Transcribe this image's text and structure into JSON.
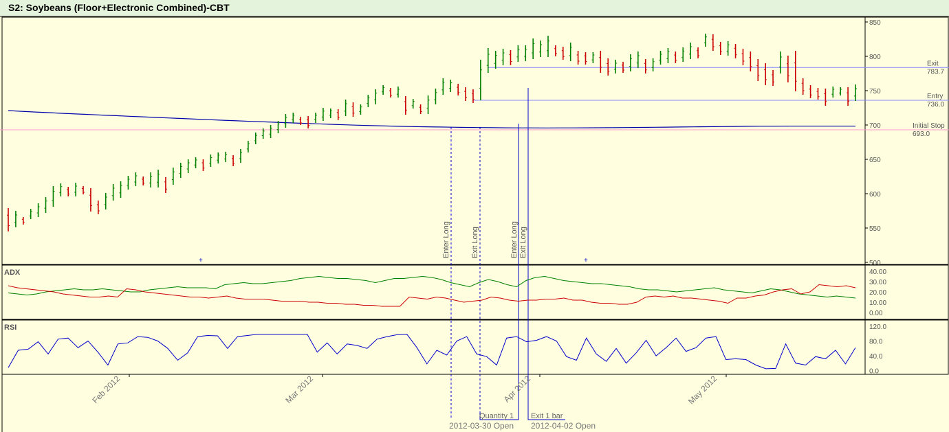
{
  "title": "S2: Soybeans (Floor+Electronic Combined)-CBT",
  "chart_data": [
    {
      "type": "bar",
      "subtype": "ohlc",
      "yticks": [
        "850",
        "800",
        "750",
        "700",
        "650",
        "600",
        "550",
        "500"
      ],
      "ylim": [
        497,
        857
      ],
      "xticks": [
        "Feb 2012",
        "Mar 2012",
        "Apr 2012",
        "May 2012"
      ],
      "colors": {
        "up": "#008000",
        "down": "#cc0000",
        "ma": "#0000aa"
      },
      "bars": [
        [
          579,
          545
        ],
        [
          575,
          551
        ],
        [
          566,
          555
        ],
        [
          578,
          563
        ],
        [
          586,
          566
        ],
        [
          595,
          572
        ],
        [
          611,
          581
        ],
        [
          615,
          596
        ],
        [
          610,
          596
        ],
        [
          616,
          596
        ],
        [
          611,
          599
        ],
        [
          608,
          574
        ],
        [
          590,
          570
        ],
        [
          601,
          577
        ],
        [
          614,
          590
        ],
        [
          618,
          594
        ],
        [
          626,
          606
        ],
        [
          631,
          611
        ],
        [
          625,
          612
        ],
        [
          631,
          609
        ],
        [
          635,
          609
        ],
        [
          624,
          601
        ],
        [
          638,
          613
        ],
        [
          645,
          623
        ],
        [
          650,
          630
        ],
        [
          653,
          637
        ],
        [
          650,
          633
        ],
        [
          657,
          639
        ],
        [
          660,
          644
        ],
        [
          661,
          646
        ],
        [
          656,
          640
        ],
        [
          665,
          645
        ],
        [
          677,
          660
        ],
        [
          689,
          672
        ],
        [
          695,
          680
        ],
        [
          700,
          681
        ],
        [
          706,
          688
        ],
        [
          716,
          696
        ],
        [
          718,
          703
        ],
        [
          712,
          700
        ],
        [
          713,
          695
        ],
        [
          718,
          703
        ],
        [
          725,
          706
        ],
        [
          724,
          710
        ],
        [
          723,
          707
        ],
        [
          737,
          713
        ],
        [
          733,
          712
        ],
        [
          730,
          715
        ],
        [
          744,
          726
        ],
        [
          752,
          730
        ],
        [
          758,
          744
        ],
        [
          754,
          740
        ],
        [
          756,
          740
        ],
        [
          742,
          715
        ],
        [
          738,
          724
        ],
        [
          730,
          716
        ],
        [
          743,
          716
        ],
        [
          753,
          730
        ],
        [
          768,
          744
        ],
        [
          766,
          748
        ],
        [
          760,
          743
        ],
        [
          755,
          735
        ],
        [
          752,
          732
        ],
        [
          795,
          736
        ],
        [
          812,
          776
        ],
        [
          808,
          782
        ],
        [
          811,
          787
        ],
        [
          809,
          787
        ],
        [
          816,
          792
        ],
        [
          816,
          793
        ],
        [
          826,
          796
        ],
        [
          823,
          799
        ],
        [
          830,
          799
        ],
        [
          816,
          800
        ],
        [
          814,
          795
        ],
        [
          820,
          793
        ],
        [
          808,
          788
        ],
        [
          806,
          788
        ],
        [
          806,
          790
        ],
        [
          808,
          776
        ],
        [
          797,
          772
        ],
        [
          795,
          775
        ],
        [
          792,
          776
        ],
        [
          803,
          778
        ],
        [
          807,
          783
        ],
        [
          796,
          775
        ],
        [
          797,
          778
        ],
        [
          808,
          788
        ],
        [
          812,
          790
        ],
        [
          807,
          790
        ],
        [
          813,
          792
        ],
        [
          820,
          796
        ],
        [
          813,
          797
        ],
        [
          833,
          814
        ],
        [
          832,
          808
        ],
        [
          821,
          802
        ],
        [
          822,
          801
        ],
        [
          818,
          797
        ],
        [
          811,
          787
        ],
        [
          807,
          778
        ],
        [
          796,
          764
        ],
        [
          790,
          758
        ],
        [
          780,
          757
        ],
        [
          807,
          775
        ],
        [
          801,
          762
        ],
        [
          808,
          749
        ],
        [
          768,
          744
        ],
        [
          758,
          739
        ],
        [
          754,
          737
        ],
        [
          753,
          728
        ],
        [
          756,
          740
        ],
        [
          755,
          743
        ],
        [
          755,
          728
        ],
        [
          759,
          735
        ]
      ],
      "series": [
        {
          "values": [
            721.0,
            719.9,
            718.9,
            718.0,
            717.0,
            716.1,
            715.3,
            714.4,
            713.6,
            712.7,
            711.9,
            711.0,
            710.2,
            709.4,
            708.5,
            707.7,
            706.9,
            706.1,
            705.3,
            704.6,
            703.9,
            703.1,
            702.4,
            701.7,
            701.0,
            700.3,
            699.7,
            699.1,
            698.6,
            698.1,
            697.7,
            697.4,
            697.1,
            696.8,
            696.5,
            696.3,
            696.1,
            695.9,
            695.8,
            695.8,
            695.7,
            695.8,
            695.8,
            695.9,
            696.0,
            696.1,
            696.3,
            696.5,
            696.7,
            696.9,
            697.1,
            697.3,
            697.5,
            697.7,
            697.9,
            698.1,
            698.2,
            698.2,
            698.3,
            698.3,
            698.3,
            698.3,
            698.3,
            698.3
          ]
        }
      ],
      "annotations": [
        {
          "label": "Exit",
          "value_label": "783.7",
          "value": 783.7
        },
        {
          "label": "Entry",
          "value_label": "736.0",
          "value": 736.0
        },
        {
          "label": "Initial Stop",
          "value_label": "693.0",
          "value": 693.0
        }
      ],
      "signals": [
        "Enter Long",
        "Exit Long",
        "Enter Long",
        "Exit Long"
      ],
      "trade_labels": [
        "Quantity 1",
        "2012-03-30 Open",
        "Exit 1 bar",
        "2012-04-02 Open"
      ]
    },
    {
      "type": "line",
      "panel": "ADX",
      "title": "ADX",
      "yticks": [
        "40.00",
        "30.00",
        "20.00",
        "10.00",
        "0.00"
      ],
      "ylim": [
        0,
        40
      ],
      "series": [
        {
          "color": "#008000",
          "values": [
            19,
            18,
            17,
            18,
            20,
            21,
            22,
            23,
            22,
            22,
            23,
            22,
            21,
            20,
            20,
            22,
            23,
            24,
            25,
            24,
            24,
            24,
            23,
            27,
            28,
            29,
            28,
            28,
            29,
            30,
            31,
            33,
            34,
            35,
            34,
            33,
            33,
            32,
            31,
            29,
            31,
            33,
            33,
            34,
            35,
            34,
            32,
            29,
            27,
            25,
            29,
            32,
            30,
            27,
            25,
            31,
            34,
            35,
            33,
            31,
            30,
            29,
            28,
            28,
            27,
            26,
            25,
            23,
            22,
            22,
            21,
            20,
            21,
            22,
            23,
            24,
            22,
            21,
            20,
            19,
            21,
            23,
            22,
            20,
            18,
            17,
            16,
            15,
            16,
            15,
            14
          ]
        },
        {
          "color": "#cc0000",
          "values": [
            26,
            24,
            23,
            22,
            21,
            20,
            18,
            17,
            16,
            15,
            15,
            16,
            15,
            23,
            22,
            20,
            19,
            18,
            17,
            16,
            15,
            15,
            14,
            15,
            16,
            14,
            13,
            13,
            13,
            12,
            11,
            11,
            11,
            10,
            10,
            9,
            9,
            8,
            8,
            7,
            7,
            6,
            6,
            6,
            15,
            14,
            13,
            15,
            14,
            12,
            10,
            11,
            12,
            15,
            14,
            12,
            11,
            12,
            12,
            13,
            13,
            14,
            12,
            12,
            10,
            9,
            9,
            8,
            8,
            10,
            15,
            16,
            15,
            16,
            14,
            14,
            13,
            12,
            11,
            9,
            14,
            14,
            16,
            17,
            20,
            22,
            23,
            18,
            20,
            27,
            26,
            25,
            26,
            24
          ]
        }
      ]
    },
    {
      "type": "line",
      "panel": "RSI",
      "title": "RSI",
      "yticks": [
        "120.0",
        "80.0",
        "40.0",
        "0.0"
      ],
      "ylim": [
        -10,
        120
      ],
      "series": [
        {
          "color": "#0000cc",
          "values": [
            8,
            55,
            58,
            78,
            45,
            85,
            88,
            62,
            80,
            50,
            15,
            72,
            75,
            92,
            90,
            80,
            60,
            28,
            48,
            92,
            95,
            94,
            60,
            92,
            95,
            98,
            98,
            98,
            98,
            98,
            98,
            50,
            75,
            45,
            72,
            68,
            60,
            85,
            92,
            97,
            98,
            62,
            18,
            55,
            42,
            80,
            92,
            45,
            38,
            15,
            88,
            92,
            78,
            82,
            92,
            80,
            38,
            28,
            88,
            45,
            25,
            60,
            20,
            48,
            82,
            40,
            62,
            88,
            52,
            62,
            88,
            92,
            30,
            32,
            30,
            15,
            5,
            6,
            72,
            20,
            15,
            38,
            32,
            55,
            18,
            62
          ]
        }
      ]
    }
  ]
}
